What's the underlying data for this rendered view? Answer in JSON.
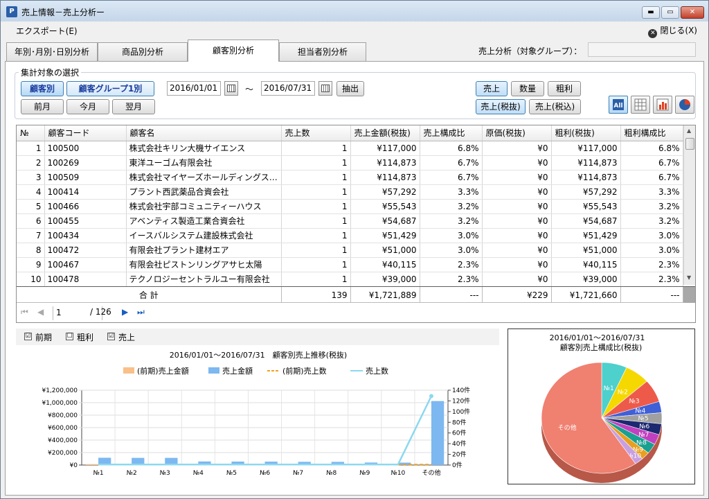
{
  "window": {
    "title": "売上情報－売上分析ー",
    "min": "▬",
    "max": "▭",
    "close": "✕"
  },
  "menu": {
    "export": "エクスポート(E)",
    "close": "閉じる(X)",
    "close_glyph": "✕"
  },
  "tabs": [
    "年別･月別･日別分析",
    "商品別分析",
    "顧客別分析",
    "担当者別分析"
  ],
  "group": {
    "label": "売上分析（対象グループ）："
  },
  "filter": {
    "legend": "集計対象の選択",
    "customer": "顧客別",
    "customer_group": "顧客グループ1別",
    "prev_month": "前月",
    "this_month": "今月",
    "next_month": "翌月",
    "date_from": "2016/01/01",
    "tilde": "～",
    "date_to": "2016/07/31",
    "extract": "抽出",
    "sales": "売上",
    "quantity": "数量",
    "gross": "粗利",
    "sales_excl": "売上(税抜)",
    "sales_incl": "売上(税込)"
  },
  "grid": {
    "headers": [
      "№",
      "顧客コード",
      "顧客名",
      "売上数",
      "売上金額(税抜)",
      "売上構成比",
      "原価(税抜)",
      "粗利(税抜)",
      "粗利構成比"
    ],
    "rows": [
      [
        "1",
        "100500",
        "株式会社キリン大機サイエンス",
        "1",
        "¥117,000",
        "6.8%",
        "¥0",
        "¥117,000",
        "6.8%"
      ],
      [
        "2",
        "100269",
        "東洋ユーゴム有限会社",
        "1",
        "¥114,873",
        "6.7%",
        "¥0",
        "¥114,873",
        "6.7%"
      ],
      [
        "3",
        "100509",
        "株式会社マイヤーズホールディングス国際...",
        "1",
        "¥114,873",
        "6.7%",
        "¥0",
        "¥114,873",
        "6.7%"
      ],
      [
        "4",
        "100414",
        "プラント西武薬品合資会社",
        "1",
        "¥57,292",
        "3.3%",
        "¥0",
        "¥57,292",
        "3.3%"
      ],
      [
        "5",
        "100466",
        "株式会社宇部コミュニティーハウス",
        "1",
        "¥55,543",
        "3.2%",
        "¥0",
        "¥55,543",
        "3.2%"
      ],
      [
        "6",
        "100455",
        "アベンティス製造工業合資会社",
        "1",
        "¥54,687",
        "3.2%",
        "¥0",
        "¥54,687",
        "3.2%"
      ],
      [
        "7",
        "100434",
        "イースバルシステム建設株式会社",
        "1",
        "¥51,429",
        "3.0%",
        "¥0",
        "¥51,429",
        "3.0%"
      ],
      [
        "8",
        "100472",
        "有限会社プラント建材エア",
        "1",
        "¥51,000",
        "3.0%",
        "¥0",
        "¥51,000",
        "3.0%"
      ],
      [
        "9",
        "100467",
        "有限会社ピストンリングアサヒ太陽",
        "1",
        "¥40,115",
        "2.3%",
        "¥0",
        "¥40,115",
        "2.3%"
      ],
      [
        "10",
        "100478",
        "テクノロジーセントラルユー有限会社",
        "1",
        "¥39,000",
        "2.3%",
        "¥0",
        "¥39,000",
        "2.3%"
      ]
    ],
    "total": {
      "label": "合 計",
      "count": "139",
      "amount": "¥1,721,889",
      "ratio": "---",
      "cost": "¥229",
      "gross": "¥1,721,660",
      "gross_ratio": "---"
    }
  },
  "pager": {
    "page": "1",
    "of": "/ 126"
  },
  "checks": {
    "prev": "前期",
    "gross": "粗利",
    "sales": "売上",
    "mark": "☑",
    "unmark": "☐"
  },
  "chart_data": [
    {
      "type": "bar",
      "title": "2016/01/01～2016/07/31　顧客別売上推移(税抜)",
      "categories": [
        "№1",
        "№2",
        "№3",
        "№4",
        "№5",
        "№6",
        "№7",
        "№8",
        "№9",
        "№10",
        "その他"
      ],
      "series": [
        {
          "name": "(前期)売上金額",
          "kind": "bar",
          "axis": "left",
          "values": [
            15000,
            12000,
            5000,
            8000,
            6000,
            4000,
            5000,
            4000,
            3000,
            2000,
            0
          ]
        },
        {
          "name": "売上金額",
          "kind": "bar",
          "axis": "left",
          "values": [
            117000,
            114873,
            114873,
            57292,
            55543,
            54687,
            51429,
            51000,
            40115,
            39000,
            1026077
          ]
        },
        {
          "name": "(前期)売上数",
          "kind": "line",
          "axis": "right",
          "values": [
            1,
            1,
            1,
            1,
            1,
            1,
            1,
            1,
            1,
            1,
            1
          ]
        },
        {
          "name": "売上数",
          "kind": "line",
          "axis": "right",
          "values": [
            1,
            1,
            1,
            1,
            1,
            1,
            1,
            1,
            1,
            1,
            129
          ]
        }
      ],
      "left_ticks": [
        "¥1,200,000",
        "¥1,000,000",
        "¥800,000",
        "¥600,000",
        "¥400,000",
        "¥200,000",
        "¥0"
      ],
      "right_ticks": [
        "140件",
        "120件",
        "100件",
        "80件",
        "60件",
        "40件",
        "20件",
        "0件"
      ],
      "ylim_left": [
        0,
        1200000
      ],
      "ylim_right": [
        0,
        140
      ],
      "colors": {
        "prev_sales": "#f9c08a",
        "sales": "#7db8f0",
        "prev_count": "#f0a020",
        "count": "#8cd8f0"
      }
    },
    {
      "type": "pie",
      "title": "2016/01/01～2016/07/31　顧客別売上構成比(税抜)",
      "labels": [
        "№1",
        "№2",
        "№3",
        "№4",
        "№5",
        "№6",
        "№7",
        "№8",
        "№9",
        "№10",
        "その他"
      ],
      "values": [
        6.8,
        6.7,
        6.7,
        3.3,
        3.2,
        3.2,
        3.0,
        3.0,
        2.3,
        2.3,
        59.5
      ],
      "colors": [
        "#4ed0cc",
        "#f5d800",
        "#ee5a4a",
        "#4060d8",
        "#a0a0a0",
        "#1c2870",
        "#c040c0",
        "#18a090",
        "#e8a020",
        "#c8a0e0",
        "#f08070"
      ]
    }
  ]
}
